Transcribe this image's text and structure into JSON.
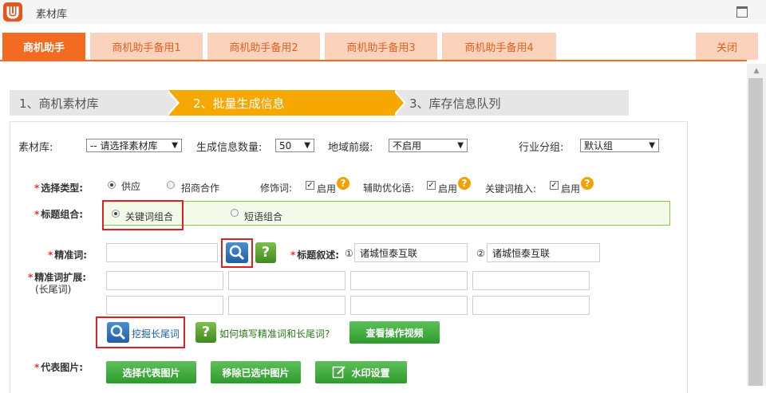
{
  "window": {
    "title": "素材库"
  },
  "tabs": [
    {
      "label": "商机助手",
      "active": true
    },
    {
      "label": "商机助手备用1",
      "active": false
    },
    {
      "label": "商机助手备用2",
      "active": false
    },
    {
      "label": "商机助手备用3",
      "active": false
    },
    {
      "label": "商机助手备用4",
      "active": false
    }
  ],
  "close_tab": "关闭",
  "steps": [
    "1、商机素材库",
    "2、批量生成信息",
    "3、库存信息队列"
  ],
  "filters": {
    "library_label": "素材库:",
    "library_value": "-- 请选择素材库",
    "count_label": "生成信息数量:",
    "count_value": "50",
    "region_label": "地域前缀:",
    "region_value": "不启用",
    "group_label": "行业分组:",
    "group_value": "默认组"
  },
  "type_row": {
    "label": "选择类型:",
    "opt_supply": "供应",
    "opt_invest": "招商合作",
    "modifier_label": "修饰词:",
    "modifier_enable": "启用",
    "assist_label": "辅助优化语:",
    "assist_enable": "启用",
    "keyword_label": "关键词植入:",
    "keyword_enable": "启用"
  },
  "title_combo": {
    "label": "标题组合:",
    "opt_keyword": "关键词组合",
    "opt_phrase": "短语组合"
  },
  "precise": {
    "label": "精准词:",
    "title_desc_label": "标题叙述:",
    "num1": "①",
    "value1": "诸城恒泰互联",
    "num2": "②",
    "value2": "诸城恒泰互联"
  },
  "extension": {
    "label": "精准词扩展:",
    "sublabel": "(长尾词)"
  },
  "actions": {
    "mine_longtail": "挖掘长尾词",
    "how_to_fill": "如何填写精准词和长尾词?",
    "watch_video": "查看操作视频"
  },
  "images": {
    "label": "代表图片:",
    "select": "选择代表图片",
    "remove": "移除已选中图片",
    "watermark": "水印设置"
  },
  "colors": {
    "accent": "#f26b21",
    "step_active": "#f6a800",
    "green": "#2f9b2c",
    "link": "#1a5fa8",
    "link_green": "#2a7a1a"
  }
}
